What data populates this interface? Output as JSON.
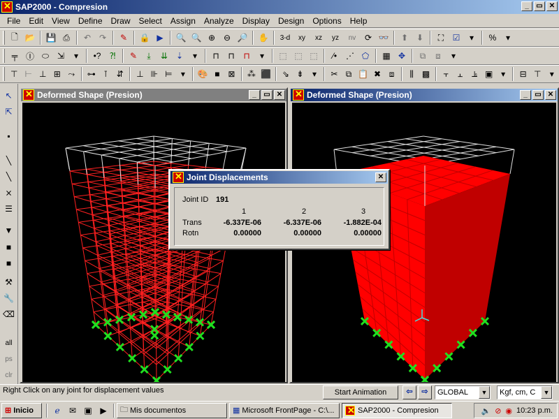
{
  "app": {
    "title": "SAP2000 - Compresion",
    "window_controls": [
      "_",
      "▭",
      "✕"
    ]
  },
  "menu": [
    "File",
    "Edit",
    "View",
    "Define",
    "Draw",
    "Select",
    "Assign",
    "Analyze",
    "Display",
    "Design",
    "Options",
    "Help"
  ],
  "toolbar1": {
    "view_buttons": [
      "3-d",
      "xy",
      "xz",
      "yz",
      "nv"
    ]
  },
  "windows": {
    "left": {
      "title": "Deformed Shape (Presion)",
      "controls": [
        "_",
        "▭",
        "✕"
      ]
    },
    "right": {
      "title": "Deformed Shape (Presion)",
      "controls": [
        "_",
        "▭",
        "✕"
      ]
    }
  },
  "dialog": {
    "title": "Joint Displacements",
    "close": "✕",
    "joint_label": "Joint ID",
    "joint_id": "191",
    "columns": [
      "1",
      "2",
      "3"
    ],
    "rows": [
      {
        "label": "Trans",
        "values": [
          "-6.337E-06",
          "-6.337E-06",
          "-1.882E-04"
        ]
      },
      {
        "label": "Rotn",
        "values": [
          "0.00000",
          "0.00000",
          "0.00000"
        ]
      }
    ]
  },
  "status": {
    "message": "Right Click on any joint for displacement values",
    "animation_button": "Start Animation",
    "coord_system": "GLOBAL",
    "units": "Kgf, cm, C"
  },
  "taskbar": {
    "start": "Inicio",
    "tasks": [
      "Mis documentos",
      "Microsoft FrontPage - C:\\...",
      "SAP2000 - Compresion"
    ],
    "clock": "10:23 p.m."
  },
  "left_toolbar": [
    "all",
    "ps",
    "clr"
  ],
  "colors": {
    "frame_red": "#ff2020",
    "grid_white": "#e0e0e0",
    "support_green": "#20e020",
    "solid_front": "#ff0000",
    "solid_side": "#c00000",
    "title_blue": "#0a246a"
  }
}
